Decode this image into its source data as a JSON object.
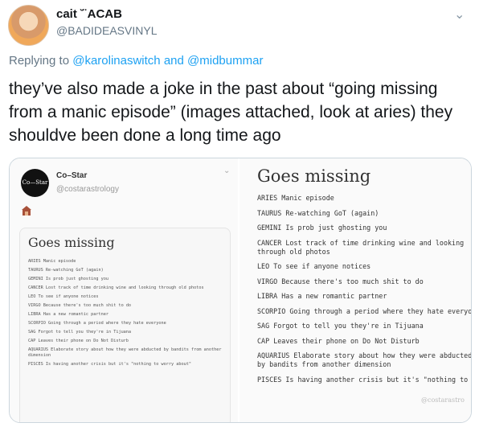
{
  "tweet": {
    "display_name": "cait ˘̈ ACAB",
    "handle": "@BADIDEASVINYL",
    "reply_prefix": "Replying to",
    "reply_to_1": "@karolinaswitch",
    "reply_and": "and",
    "reply_to_2": "@midbummar",
    "text": "they’ve also made a joke in the past about “going missing from a manic episode” (images attached, look at aries) they shouldve been done a long time ago",
    "menu_icon": "chevron-down-icon"
  },
  "image_left": {
    "account_name": "Co–Star",
    "account_handle": "@costarastrology",
    "avatar_text": "Co—Star",
    "title": "Goes missing",
    "items": [
      {
        "sign": "ARIES",
        "text": "Manic episode"
      },
      {
        "sign": "TAURUS",
        "text": "Re-watching GoT (again)"
      },
      {
        "sign": "GEMINI",
        "text": "Is prob just ghosting you"
      },
      {
        "sign": "CANCER",
        "text": "Lost track of time drinking wine and looking through old photos"
      },
      {
        "sign": "LEO",
        "text": "To see if anyone notices"
      },
      {
        "sign": "VIRGO",
        "text": "Because there's too much shit to do"
      },
      {
        "sign": "LIBRA",
        "text": "Has a new romantic partner"
      },
      {
        "sign": "SCORPIO",
        "text": "Going through a period where they hate everyone"
      },
      {
        "sign": "SAG",
        "text": "Forgot to tell you they're in Tijuana"
      },
      {
        "sign": "CAP",
        "text": "Leaves their phone on Do Not Disturb"
      },
      {
        "sign": "AQUARIUS",
        "text": "Elaborate story about how they were abducted by bandits from another dimension"
      },
      {
        "sign": "PISCES",
        "text": "Is having another crisis but it's \"nothing to worry about\""
      }
    ]
  },
  "image_right": {
    "title": "Goes missing",
    "items": [
      {
        "sign": "ARIES",
        "text": "Manic episode"
      },
      {
        "sign": "TAURUS",
        "text": "Re-watching GoT (again)"
      },
      {
        "sign": "GEMINI",
        "text": "Is prob just ghosting you"
      },
      {
        "sign": "CANCER",
        "text": "Lost track of time drinking wine and looking through old photos"
      },
      {
        "sign": "LEO",
        "text": "To see if anyone notices"
      },
      {
        "sign": "VIRGO",
        "text": "Because there's too much shit to do"
      },
      {
        "sign": "LIBRA",
        "text": "Has a new romantic partner"
      },
      {
        "sign": "SCORPIO",
        "text": "Going through a period where they hate everyone"
      },
      {
        "sign": "SAG",
        "text": "Forgot to tell you they're in Tijuana"
      },
      {
        "sign": "CAP",
        "text": "Leaves their phone on Do Not Disturb"
      },
      {
        "sign": "AQUARIUS",
        "text": "Elaborate story about how they were abducted by bandits from another dimension"
      },
      {
        "sign": "PISCES",
        "text": "Is having another crisis but it's \"nothing to worry about\""
      }
    ],
    "watermark": "@costarastro"
  }
}
